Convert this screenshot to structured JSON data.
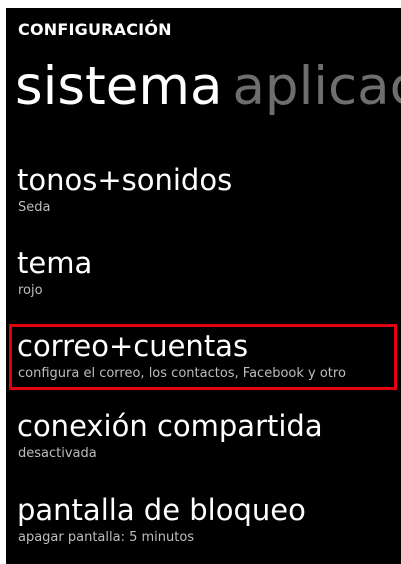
{
  "header": {
    "app_title": "CONFIGURACIÓN"
  },
  "pivot": {
    "active": "sistema",
    "next": "aplicac"
  },
  "items": [
    {
      "title": "tonos+sonidos",
      "subtitle": "Seda"
    },
    {
      "title": "tema",
      "subtitle": "rojo"
    },
    {
      "title": "correo+cuentas",
      "subtitle": "configura el correo, los contactos, Facebook y otro"
    },
    {
      "title": "conexión compartida",
      "subtitle": "desactivada"
    },
    {
      "title": "pantalla de bloqueo",
      "subtitle": "apagar pantalla: 5 minutos"
    }
  ],
  "colors": {
    "background": "#000000",
    "highlight": "#e3000f"
  }
}
